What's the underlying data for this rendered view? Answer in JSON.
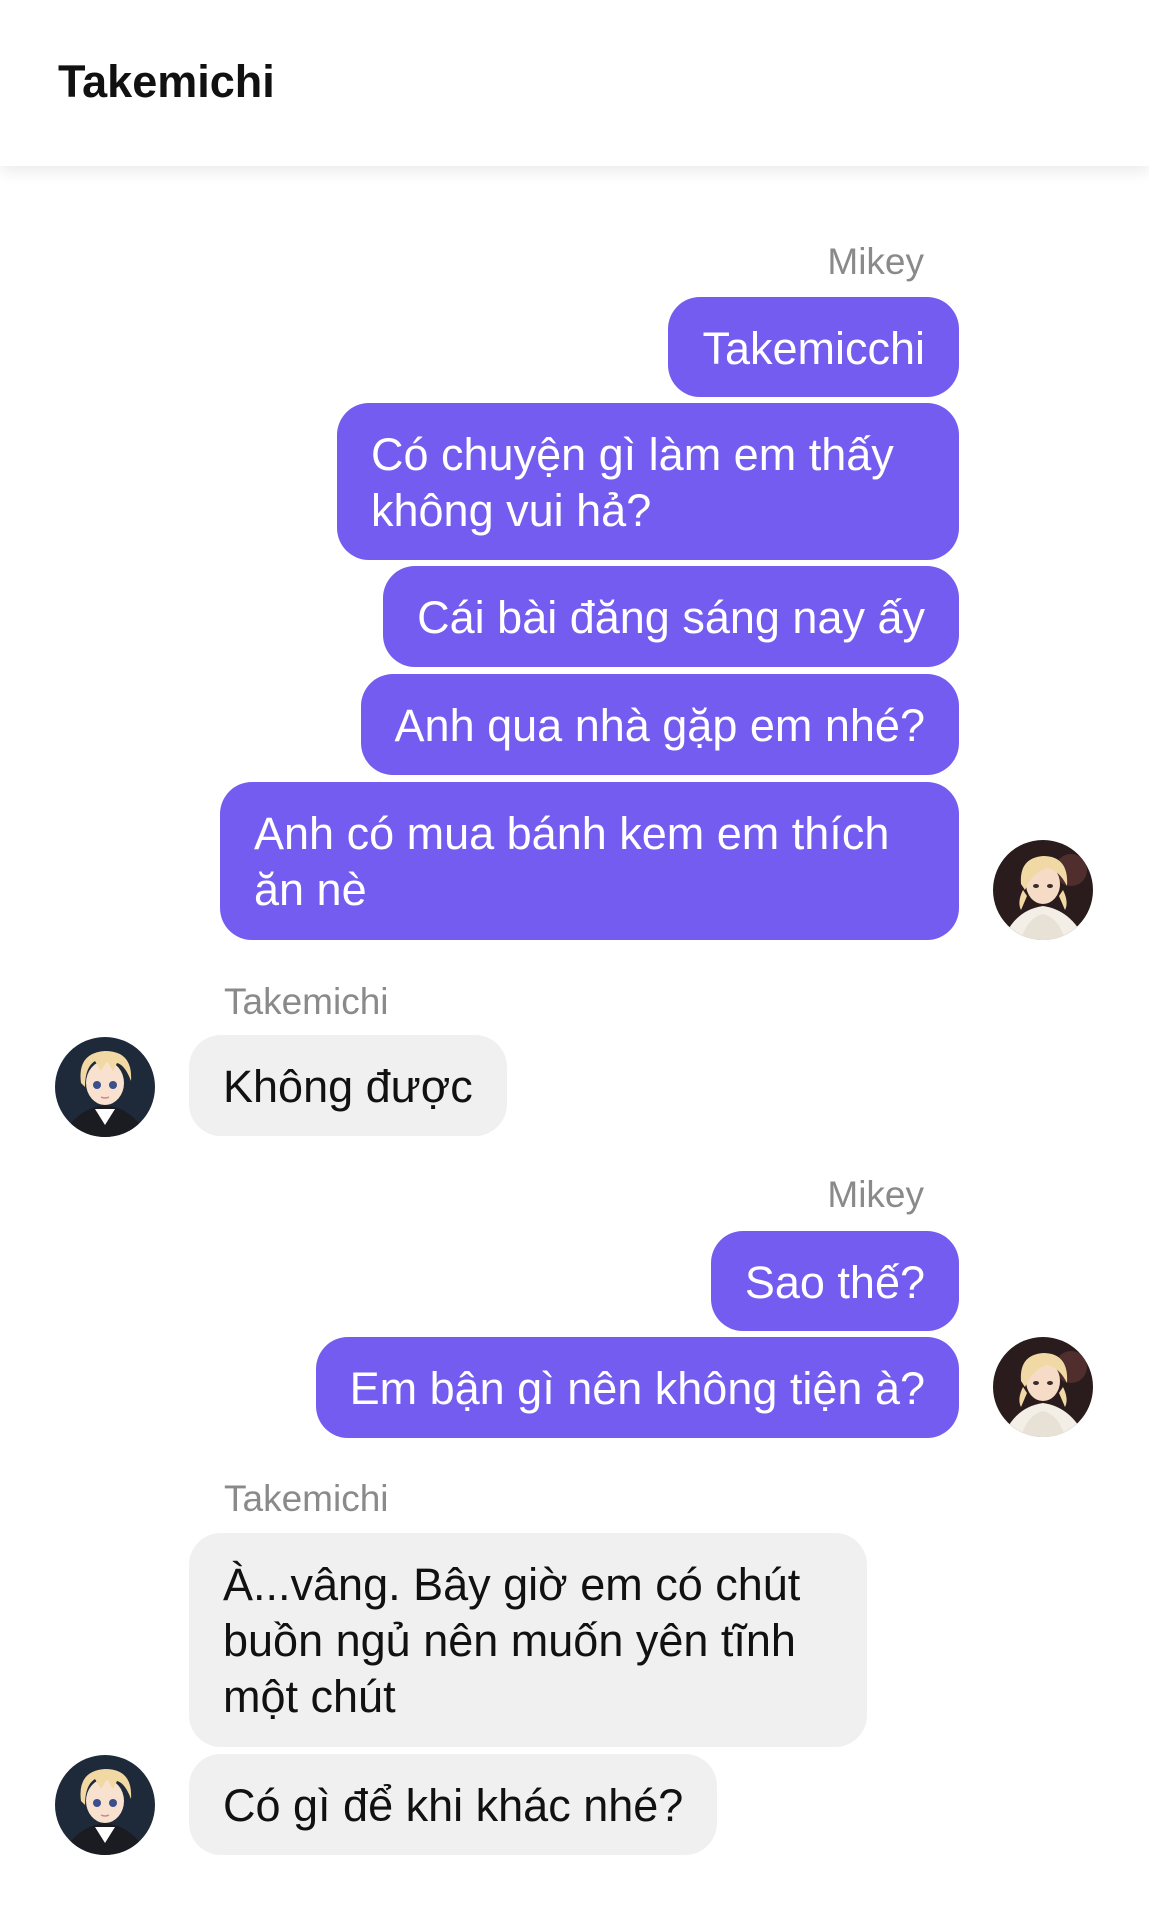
{
  "header": {
    "title": "Takemichi"
  },
  "messages": [
    {
      "sender": "Mikey",
      "side": "out",
      "bubbles": [
        "Takemicchi",
        "Có chuyện gì làm em thấy không vui hả?",
        "Cái bài đăng sáng nay ấy",
        "Anh qua nhà gặp em nhé?",
        "Anh có mua bánh kem em thích ăn nè"
      ]
    },
    {
      "sender": "Takemichi",
      "side": "in",
      "bubbles": [
        "Không được"
      ]
    },
    {
      "sender": "Mikey",
      "side": "out",
      "bubbles": [
        "Sao thế?",
        "Em bận gì nên không tiện à?"
      ]
    },
    {
      "sender": "Takemichi",
      "side": "in",
      "bubbles": [
        "À...vâng. Bây giờ em có chút buồn ngủ nên muốn yên tĩnh một chút",
        "Có gì để khi khác nhé?"
      ]
    }
  ],
  "avatars": {
    "mikey": "mikey-avatar",
    "takemichi": "takemichi-avatar"
  },
  "colors": {
    "outgoing": "#755cf0",
    "incoming": "#f0f0f0",
    "sender_label": "#8a8a8a"
  }
}
